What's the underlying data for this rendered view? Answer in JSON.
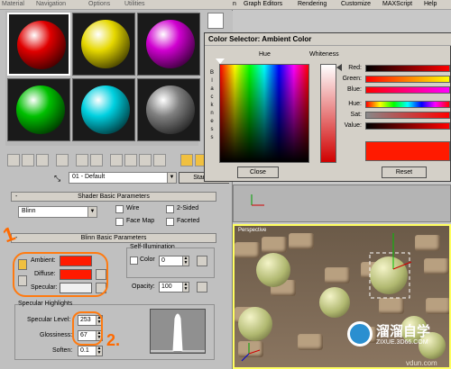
{
  "menubar": {
    "material": "Material",
    "navigation": "Navigation",
    "options": "Options",
    "utilities": "Utilities",
    "items": [
      "n",
      "Graph Editors",
      "Rendering",
      "Customize",
      "MAXScript",
      "Help"
    ]
  },
  "slots": [
    {
      "color": "#e00000"
    },
    {
      "color": "#e6d800"
    },
    {
      "color": "#d000d0"
    },
    {
      "color": "#00c000"
    },
    {
      "color": "#00d0e0"
    },
    {
      "color": "#808080"
    }
  ],
  "material": {
    "name": "01 - Default",
    "type_button": "Standar"
  },
  "shader_params": {
    "title": "Shader Basic Parameters",
    "shader": "Blinn",
    "wire": "Wire",
    "two_sided": "2-Sided",
    "face_map": "Face Map",
    "faceted": "Faceted"
  },
  "blinn_params": {
    "title": "Blinn Basic Parameters",
    "self_illum": "Self-Illumination",
    "color": "Color",
    "color_value": "0",
    "ambient": "Ambient:",
    "diffuse": "Diffuse:",
    "specular": "Specular:",
    "opacity": "Opacity:",
    "opacity_value": "100",
    "ambient_color": "#ff1a00",
    "diffuse_color": "#ff1a00",
    "specular_color": "#f0f0f0"
  },
  "specular_highlights": {
    "title": "Specular Highlights",
    "level_label": "Specular Level:",
    "level_value": "253",
    "gloss_label": "Glossiness:",
    "gloss_value": "67",
    "soften_label": "Soften:",
    "soften_value": "0.1"
  },
  "color_selector": {
    "title": "Color Selector: Ambient Color",
    "hue_header": "Hue",
    "whiteness_header": "Whiteness",
    "blackness": [
      "B",
      "l",
      "a",
      "c",
      "k",
      "n",
      "e",
      "s",
      "s"
    ],
    "labels": [
      "Red:",
      "Green:",
      "Blue:",
      "Hue:",
      "Sat:",
      "Value:"
    ],
    "close": "Close",
    "reset": "Reset",
    "result_color": "#ff1a00"
  },
  "viewport": {
    "label": "Perspective"
  },
  "annotations": {
    "one": "1",
    "two": "2."
  },
  "watermark": {
    "brand": "溜溜自学",
    "url": "ZIXUE.3D66.COM",
    "footer": "vdun.com"
  }
}
